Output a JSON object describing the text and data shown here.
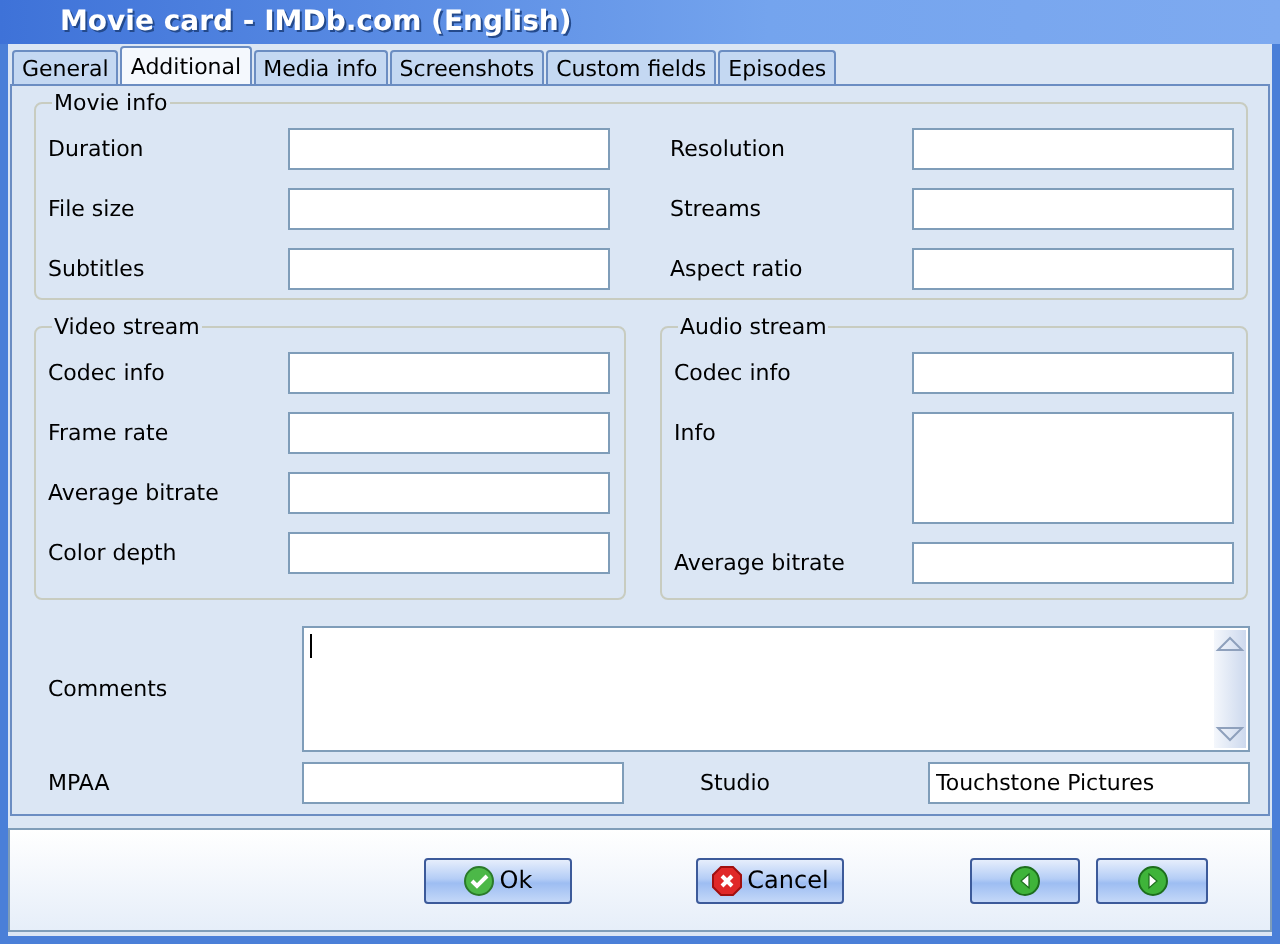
{
  "window": {
    "title": "Movie card - IMDb.com (English)"
  },
  "tabs": [
    {
      "label": "General",
      "selected": false
    },
    {
      "label": "Additional",
      "selected": true
    },
    {
      "label": "Media info",
      "selected": false
    },
    {
      "label": "Screenshots",
      "selected": false
    },
    {
      "label": "Custom fields",
      "selected": false
    },
    {
      "label": "Episodes",
      "selected": false
    }
  ],
  "movie_info": {
    "title": "Movie info",
    "fields": [
      {
        "label": "Duration",
        "kind": "line"
      },
      {
        "label": "Resolution",
        "kind": "line"
      },
      {
        "label": "File size",
        "kind": "line"
      },
      {
        "label": "Streams",
        "kind": "line"
      },
      {
        "label": "Subtitles",
        "kind": "line"
      },
      {
        "label": "Aspect ratio",
        "kind": "line"
      }
    ]
  },
  "video_stream": {
    "title": "Video stream",
    "fields": [
      {
        "label": "Codec info",
        "kind": "line"
      },
      {
        "label": "Frame rate",
        "kind": "line"
      },
      {
        "label": "Average bitrate",
        "kind": "line"
      },
      {
        "label": "Color depth",
        "kind": "line"
      }
    ]
  },
  "audio_stream": {
    "title": "Audio stream",
    "fields": [
      {
        "label": "Codec info",
        "kind": "line"
      },
      {
        "label": "Info",
        "kind": "multiline"
      },
      {
        "label": "Average bitrate",
        "kind": "line"
      }
    ]
  },
  "comments": {
    "label": "Comments"
  },
  "mpaa": {
    "label": "MPAA"
  },
  "studio": {
    "label": "Studio",
    "value": "Touchstone Pictures"
  },
  "buttons": [
    {
      "kind": "ok",
      "label": "Ok"
    },
    {
      "kind": "cancel",
      "label": "Cancel"
    },
    {
      "kind": "previous"
    },
    {
      "kind": "next"
    }
  ]
}
